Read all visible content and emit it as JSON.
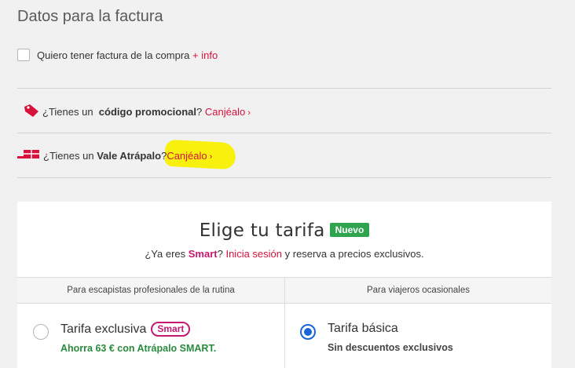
{
  "section_title": "Datos para la factura",
  "invoice": {
    "label": "Quiero tener factura de la compra",
    "info_link": "+ info"
  },
  "promo": {
    "prefix": "¿Tienes un",
    "bold": "código promocional",
    "suffix": "?",
    "link": "Canjéalo",
    "icon": "tag-icon"
  },
  "voucher": {
    "prefix": "¿Tienes un",
    "bold": "Vale Atrápalo",
    "suffix": "?",
    "link": "Canjéalo",
    "icon": "gift-voucher-icon"
  },
  "tariff": {
    "title": "Elige tu tarifa",
    "badge": "Nuevo",
    "subtitle_prefix": "¿Ya eres",
    "subtitle_smart": "Smart",
    "subtitle_q": "?",
    "login_link": "Inicia sesión",
    "subtitle_suffix": "y reserva a precios exclusivos.",
    "columns": [
      {
        "header": "Para escapistas profesionales de la rutina"
      },
      {
        "header": "Para viajeros ocasionales"
      }
    ],
    "options": [
      {
        "title": "Tarifa exclusiva",
        "pill": "Smart",
        "subtitle": "Ahorra 63 € con Atrápalo SMART.",
        "selected": false
      },
      {
        "title": "Tarifa básica",
        "subtitle": "Sin descuentos exclusivos",
        "selected": true
      }
    ]
  },
  "colors": {
    "accent_red": "#d8123b",
    "smart_magenta": "#c7186f",
    "badge_green": "#2ea44f",
    "radio_blue": "#1a66d6",
    "highlight_yellow": "#f7f000"
  }
}
